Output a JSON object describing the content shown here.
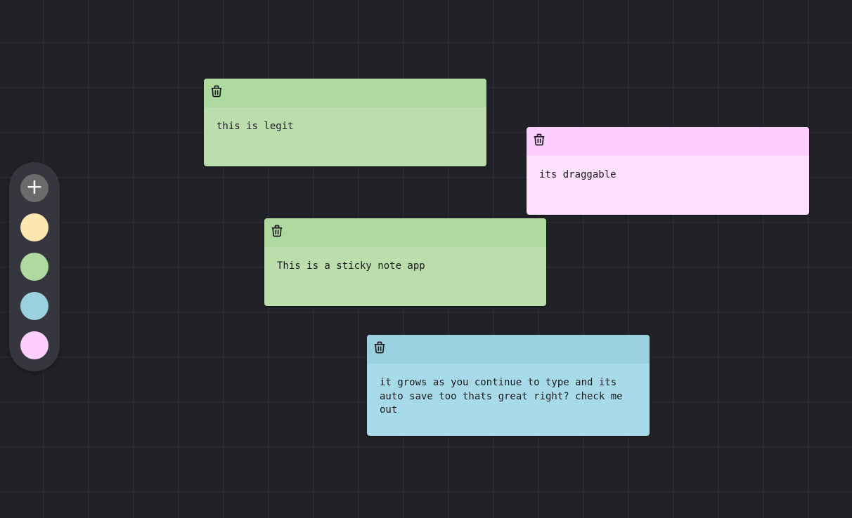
{
  "controls": {
    "add_label": "+",
    "add_icon": "plus-icon",
    "swatches": [
      {
        "name": "yellow",
        "color": "#fee6b0"
      },
      {
        "name": "green",
        "color": "#afda9f"
      },
      {
        "name": "blue",
        "color": "#9bd1de"
      },
      {
        "name": "pink",
        "color": "#fecefe"
      }
    ]
  },
  "notes": [
    {
      "color": "green",
      "header_color": "#afda9f",
      "body_color": "#bcdeac",
      "icon": "trash-icon",
      "text": "this is legit"
    },
    {
      "color": "pink",
      "header_color": "#fecefe",
      "body_color": "#fee1fe",
      "icon": "trash-icon",
      "text": "its draggable"
    },
    {
      "color": "green",
      "header_color": "#afda9f",
      "body_color": "#bcdeac",
      "icon": "trash-icon",
      "text": "This is a sticky note app"
    },
    {
      "color": "blue",
      "header_color": "#9bd1de",
      "body_color": "#a7dbe9",
      "icon": "trash-icon",
      "text": "it grows as you continue to type and its auto save too thats great right? check me out"
    }
  ]
}
